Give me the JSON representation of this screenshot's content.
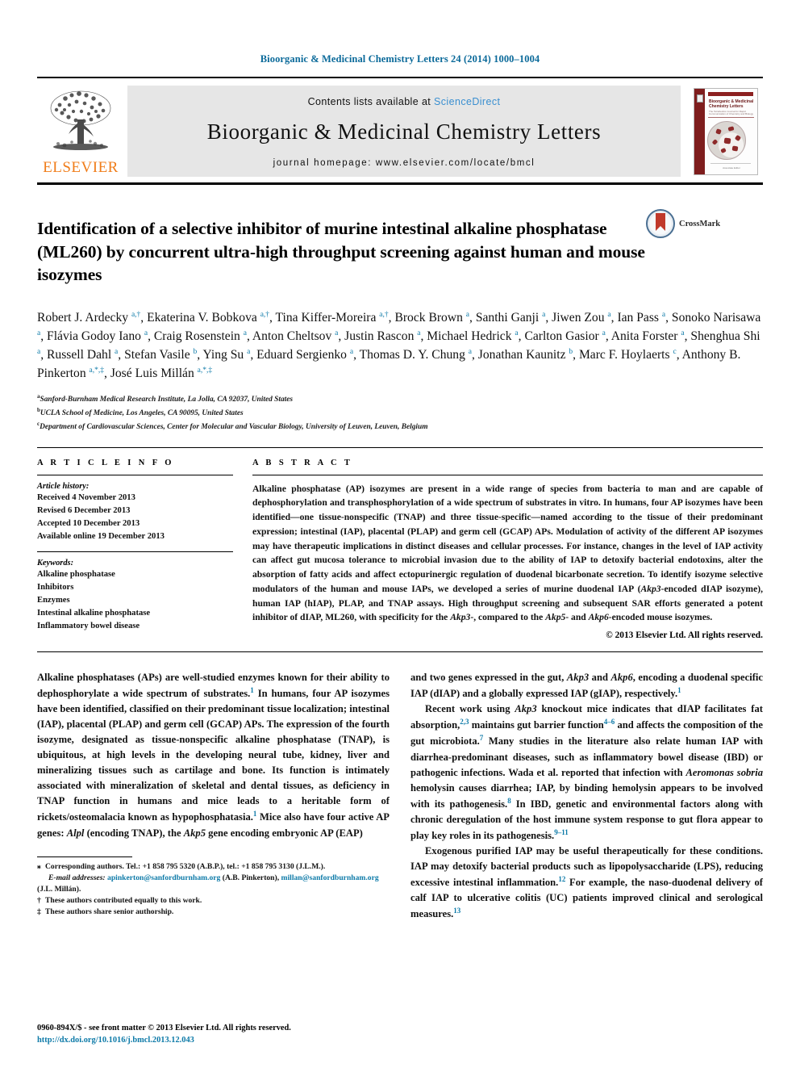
{
  "running_head": "Bioorganic & Medicinal Chemistry Letters 24 (2014) 1000–1004",
  "masthead": {
    "contents_prefix": "Contents lists available at ",
    "sciencedirect": "ScienceDirect",
    "journal_title": "Bioorganic & Medicinal Chemistry Letters",
    "homepage": "journal homepage: www.elsevier.com/locate/bmcl",
    "publisher": "ELSEVIER",
    "cover": {
      "title": "Bioorganic & Medicinal Chemistry Letters",
      "subtitle": "The Tetrahedron Journal for Rapid Communication of Chemistry and Biology",
      "footer": "Associate Editor"
    },
    "accent_orange": "#f07d1a",
    "accent_blue": "#3a8fd0",
    "band_gray": "#e6e6e6"
  },
  "article": {
    "title": "Identification of a selective inhibitor of murine intestinal alkaline phosphatase (ML260) by concurrent ultra-high throughput screening against human and mouse isozymes",
    "crossmark_label": "CrossMark",
    "authors_html": "Robert J. Ardecky <sup>a,†</sup>, Ekaterina V. Bobkova <sup>a,†</sup>, Tina Kiffer-Moreira <sup>a,†</sup>, Brock Brown <sup>a</sup>, Santhi Ganji <sup>a</sup>, Jiwen Zou <sup>a</sup>, Ian Pass <sup>a</sup>, Sonoko Narisawa <sup>a</sup>, Flávia Godoy Iano <sup>a</sup>, Craig Rosenstein <sup>a</sup>, Anton Cheltsov <sup>a</sup>, Justin Rascon <sup>a</sup>, Michael Hedrick <sup>a</sup>, Carlton Gasior <sup>a</sup>, Anita Forster <sup>a</sup>, Shenghua Shi <sup>a</sup>, Russell Dahl <sup>a</sup>, Stefan Vasile <sup>b</sup>, Ying Su <sup>a</sup>, Eduard Sergienko <sup>a</sup>, Thomas D. Y. Chung <sup>a</sup>, Jonathan Kaunitz <sup>b</sup>, Marc F. Hoylaerts <sup>c</sup>, Anthony B. Pinkerton <sup>a,*,‡</sup>, José Luis Millán <sup>a,*,‡</sup>",
    "affiliations": [
      {
        "mark": "a",
        "text": "Sanford-Burnham Medical Research Institute, La Jolla, CA 92037, United States"
      },
      {
        "mark": "b",
        "text": "UCLA School of Medicine, Los Angeles, CA 90095, United States"
      },
      {
        "mark": "c",
        "text": "Department of Cardiovascular Sciences, Center for Molecular and Vascular Biology, University of Leuven, Leuven, Belgium"
      }
    ]
  },
  "article_info": {
    "heading": "A R T I C L E   I N F O",
    "history_label": "Article history:",
    "history": [
      "Received 4 November 2013",
      "Revised 6 December 2013",
      "Accepted 10 December 2013",
      "Available online 19 December 2013"
    ],
    "keywords_label": "Keywords:",
    "keywords": [
      "Alkaline phosphatase",
      "Inhibitors",
      "Enzymes",
      "Intestinal alkaline phosphatase",
      "Inflammatory bowel disease"
    ]
  },
  "abstract": {
    "heading": "A B S T R A C T",
    "body_html": "Alkaline phosphatase (AP) isozymes are present in a wide range of species from bacteria to man and are capable of dephosphorylation and transphosphorylation of a wide spectrum of substrates in vitro. In humans, four AP isozymes have been identified—one tissue-nonspecific (TNAP) and three tissue-specific—named according to the tissue of their predominant expression; intestinal (IAP), placental (PLAP) and germ cell (GCAP) APs. Modulation of activity of the different AP isozymes may have therapeutic implications in distinct diseases and cellular processes. For instance, changes in the level of IAP activity can affect gut mucosa tolerance to microbial invasion due to the ability of IAP to detoxify bacterial endotoxins, alter the absorption of fatty acids and affect ectopurinergic regulation of duodenal bicarbonate secretion. To identify isozyme selective modulators of the human and mouse IAPs, we developed a series of murine duodenal IAP (<em>Akp3</em>-encoded dIAP isozyme), human IAP (hIAP), PLAP, and TNAP assays. High throughput screening and subsequent SAR efforts generated a potent inhibitor of dIAP, <b>ML260</b>, with specificity for the <em>Akp3</em>-, compared to the <em>Akp5</em>- and <em>Akp6</em>-encoded mouse isozymes.",
    "copyright": "© 2013 Elsevier Ltd. All rights reserved."
  },
  "body": {
    "left_column_html": "<p class=\"noindent\">Alkaline phosphatases (APs) are well-studied enzymes known for their ability to dephosphorylate a wide spectrum of substrates.<span class=\"ref\">1</span> In humans, four AP isozymes have been identified, classified on their predominant tissue localization; intestinal (IAP), placental (PLAP) and germ cell (GCAP) APs. The expression of the fourth isozyme, designated as tissue-nonspecific alkaline phosphatase (TNAP), is ubiquitous, at high levels in the developing neural tube, kidney, liver and mineralizing tissues such as cartilage and bone. Its function is intimately associated with mineralization of skeletal and dental tissues, as deficiency in TNAP function in humans and mice leads to a heritable form of rickets/osteomalacia known as hypophosphatasia.<span class=\"ref\">1</span> Mice also have four active AP genes: <em>Alpl</em> (encoding TNAP), the <em>Akp5</em> gene encoding embryonic AP (EAP)</p>",
    "right_column_html": "<p class=\"noindent\">and two genes expressed in the gut, <em>Akp3</em> and <em>Akp6</em>, encoding a duodenal specific IAP (dIAP) and a globally expressed IAP (gIAP), respectively.<span class=\"ref\">1</span></p><p>Recent work using <em>Akp3</em> knockout mice indicates that dIAP facilitates fat absorption,<span class=\"ref\">2,3</span> maintains gut barrier function<span class=\"ref\">4–6</span> and affects the composition of the gut microbiota.<span class=\"ref\">7</span> Many studies in the literature also relate human IAP with diarrhea-predominant diseases, such as inflammatory bowel disease (IBD) or pathogenic infections. Wada et al. reported that infection with <em>Aeromonas sobria</em> hemolysin causes diarrhea; IAP, by binding hemolysin appears to be involved with its pathogenesis.<span class=\"ref\">8</span> In IBD, genetic and environmental factors along with chronic deregulation of the host immune system response to gut flora appear to play key roles in its pathogenesis.<span class=\"ref\">9–11</span></p><p>Exogenous purified IAP may be useful therapeutically for these conditions. IAP may detoxify bacterial products such as lipopolysaccharide (LPS), reducing excessive intestinal inflammation.<span class=\"ref\">12</span> For example, the naso-duodenal delivery of calf IAP to ulcerative colitis (UC) patients improved clinical and serological measures.<span class=\"ref\">13</span></p>"
  },
  "footnotes": {
    "corresponding_html": "<span class=\"mark\">⁎</span> Corresponding authors. Tel.: +1 858 795 5320 (A.B.P.), tel.: +1 858 795 3130 (J.L.M.).",
    "email_html": "<i>E-mail addresses:</i> <span class=\"link\">apinkerton@sanfordburnham.org</span> (A.B. Pinkerton), <span class=\"link\">millan@sanfordburnham.org</span> (J.L. Millán).",
    "equal_contribution_html": "<span class=\"mark\">†</span> These authors contributed equally to this work.",
    "senior_authorship_html": "<span class=\"mark\">‡</span> These authors share senior authorship."
  },
  "colophon": {
    "issn_line": "0960-894X/$ - see front matter © 2013 Elsevier Ltd. All rights reserved.",
    "doi": "http://dx.doi.org/10.1016/j.bmcl.2013.12.043"
  }
}
